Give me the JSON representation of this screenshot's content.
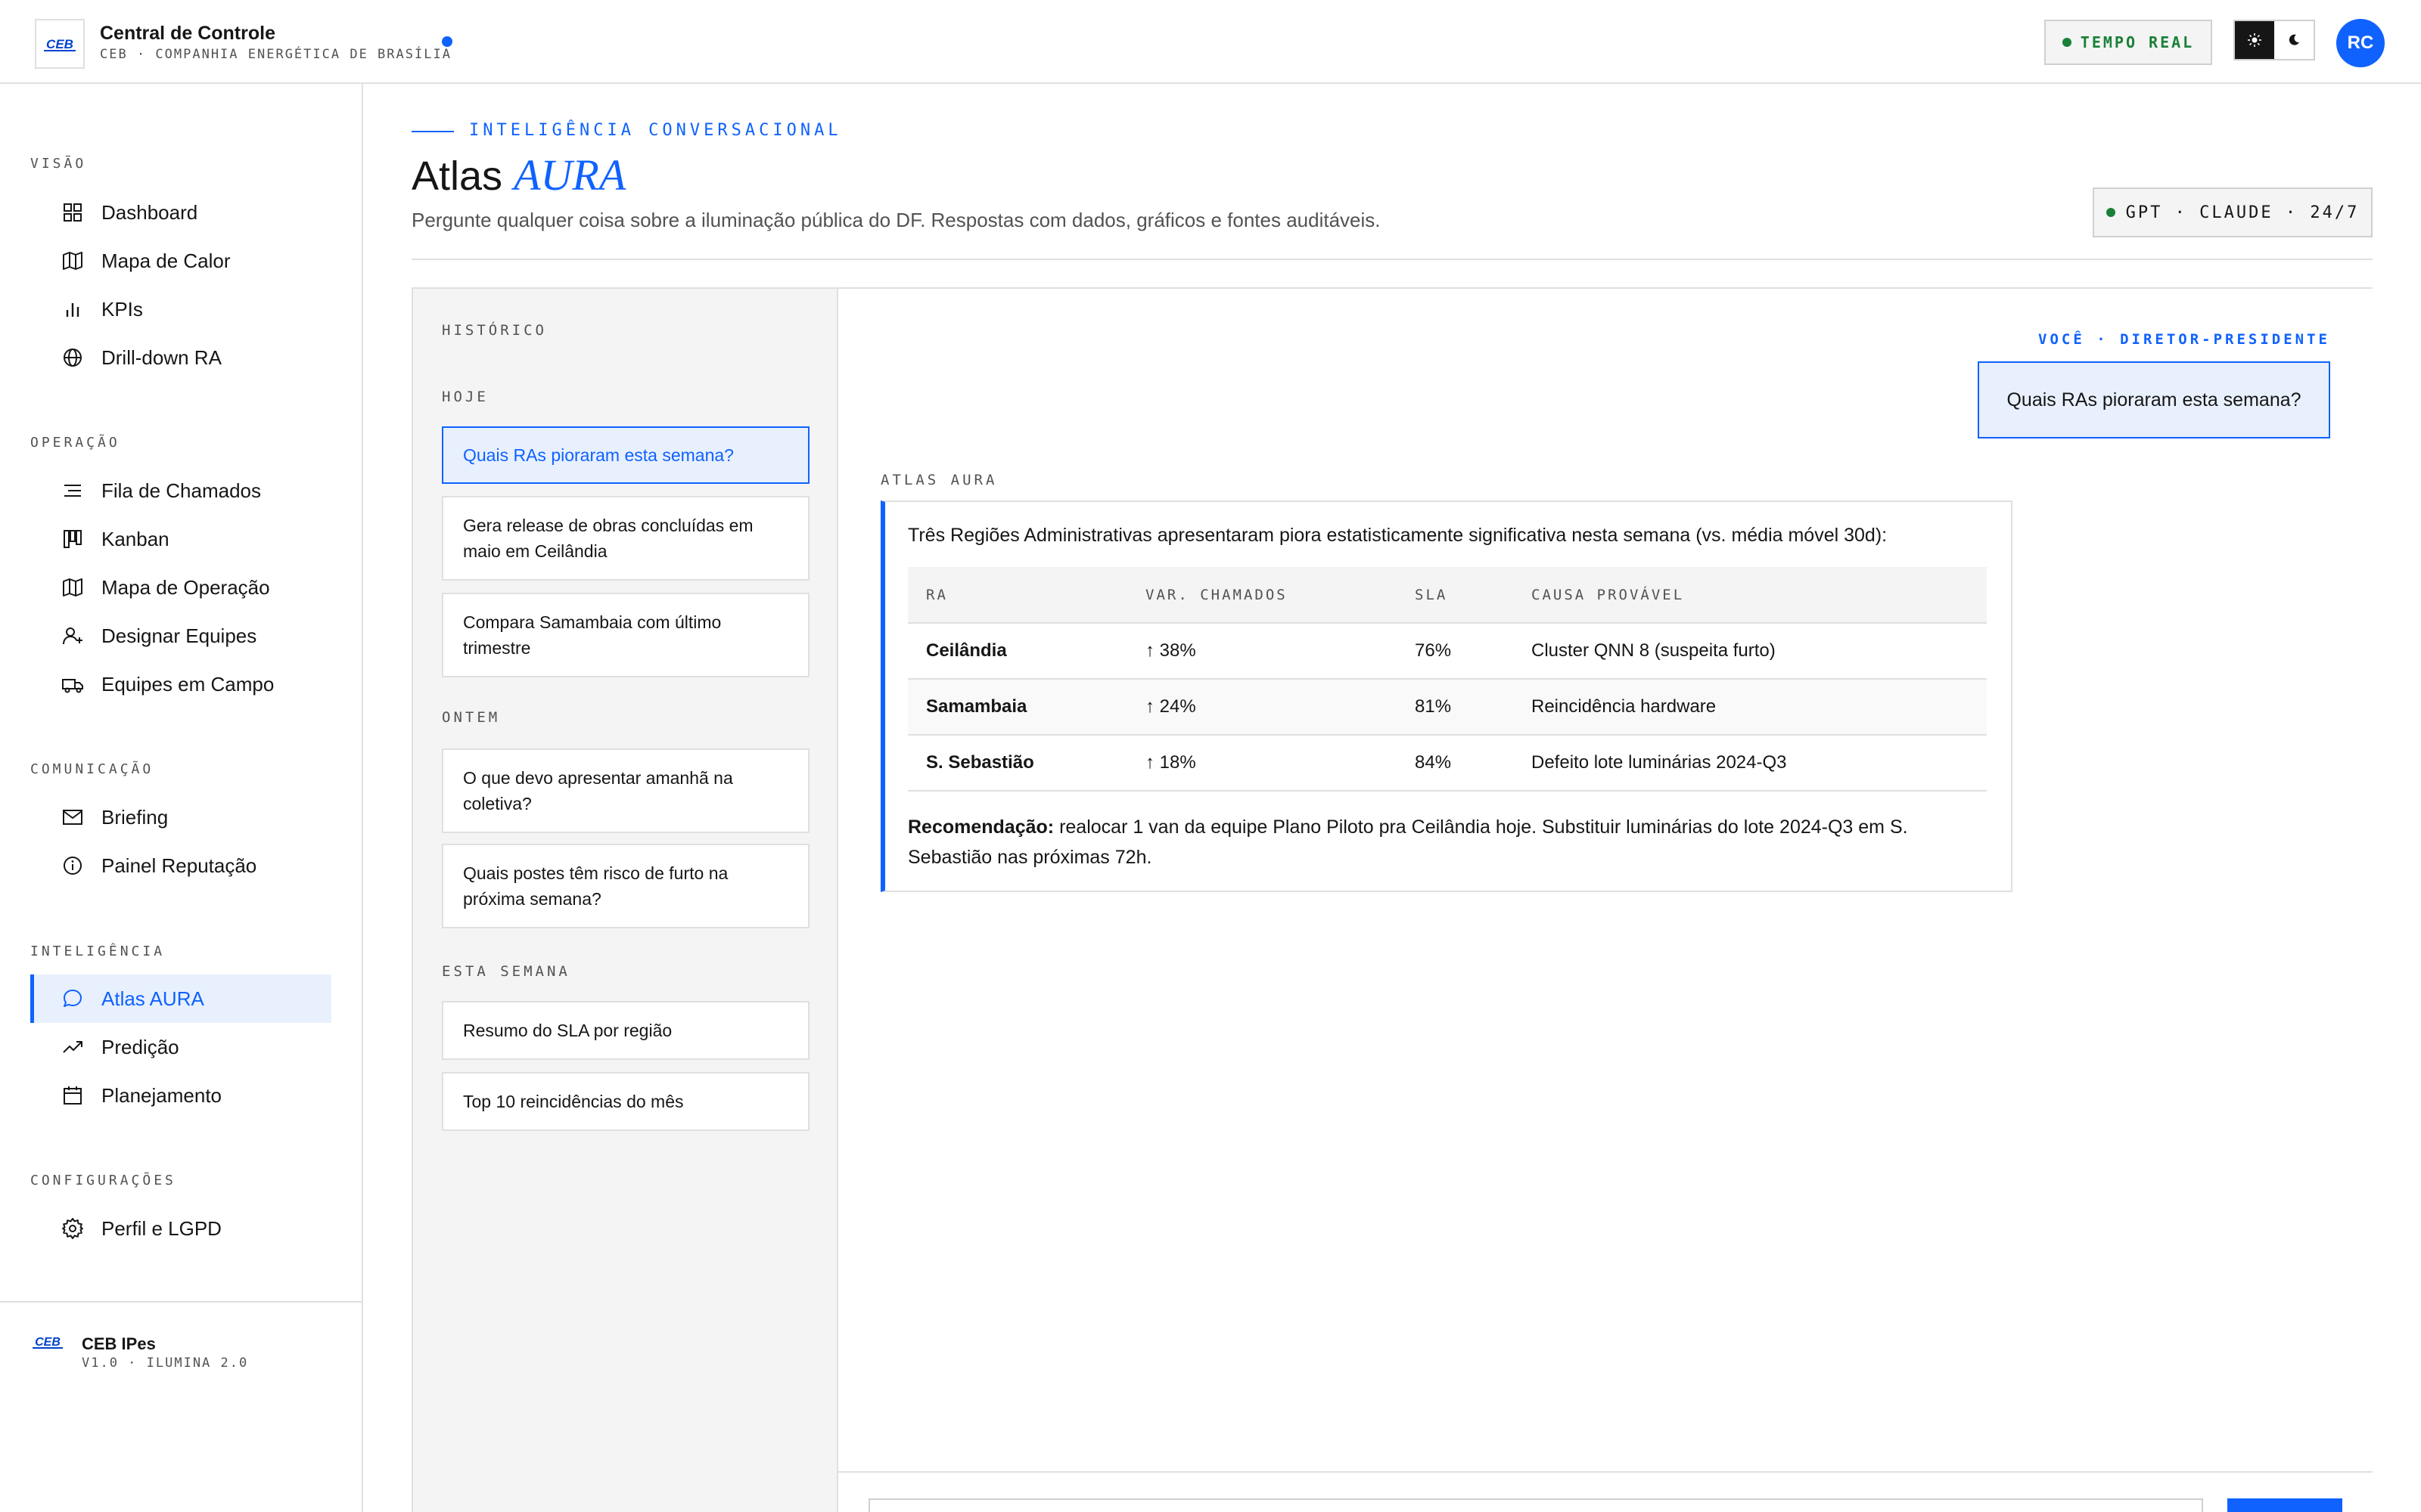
{
  "header": {
    "title": "Central de Controle",
    "subtitle": "CEB · COMPANHIA ENERGÉTICA DE BRASÍLIA",
    "realtime_label": "TEMPO REAL",
    "avatar_initials": "RC",
    "logo_text": "CEB"
  },
  "sidebar": {
    "sections": [
      {
        "label": "VISÃO",
        "items": [
          {
            "label": "Dashboard",
            "icon": "grid-icon"
          },
          {
            "label": "Mapa de Calor",
            "icon": "map-icon"
          },
          {
            "label": "KPIs",
            "icon": "bar-chart-icon"
          },
          {
            "label": "Drill-down RA",
            "icon": "globe-icon"
          }
        ]
      },
      {
        "label": "OPERAÇÃO",
        "items": [
          {
            "label": "Fila de Chamados",
            "icon": "list-icon"
          },
          {
            "label": "Kanban",
            "icon": "kanban-icon"
          },
          {
            "label": "Mapa de Operação",
            "icon": "map-icon"
          },
          {
            "label": "Designar Equipes",
            "icon": "user-plus-icon"
          },
          {
            "label": "Equipes em Campo",
            "icon": "truck-icon"
          }
        ]
      },
      {
        "label": "COMUNICAÇÃO",
        "items": [
          {
            "label": "Briefing",
            "icon": "mail-icon"
          },
          {
            "label": "Painel Reputação",
            "icon": "info-circle-icon"
          }
        ]
      },
      {
        "label": "INTELIGÊNCIA",
        "items": [
          {
            "label": "Atlas AURA",
            "icon": "chat-bubble-icon",
            "active": true
          },
          {
            "label": "Predição",
            "icon": "trend-up-icon"
          },
          {
            "label": "Planejamento",
            "icon": "calendar-icon"
          }
        ]
      },
      {
        "label": "CONFIGURAÇÕES",
        "items": [
          {
            "label": "Perfil e LGPD",
            "icon": "gear-icon"
          }
        ]
      }
    ],
    "footer": {
      "title": "CEB IPes",
      "version": "V1.0 · ILUMINA 2.0"
    }
  },
  "page": {
    "eyebrow": "INTELIGÊNCIA CONVERSACIONAL",
    "title_plain": "Atlas",
    "title_emphasis": "AURA",
    "description": "Pergunte qualquer coisa sobre a iluminação pública do DF. Respostas com dados, gráficos e fontes auditáveis.",
    "model_badge": "GPT · CLAUDE · 24/7"
  },
  "history": {
    "label": "HISTÓRICO",
    "groups": [
      {
        "label": "HOJE",
        "items": [
          "Quais RAs pioraram esta semana?",
          "Gera release de obras concluídas em maio em Ceilândia",
          "Compara Samambaia com último trimestre"
        ]
      },
      {
        "label": "ONTEM",
        "items": [
          "O que devo apresentar amanhã na coletiva?",
          "Quais postes têm risco de furto na próxima semana?"
        ]
      },
      {
        "label": "ESTA SEMANA",
        "items": [
          "Resumo do SLA por região",
          "Top 10 reincidências do mês"
        ]
      }
    ]
  },
  "chat": {
    "user_meta": "VOCÊ · DIRETOR-PRESIDENTE",
    "user_message": "Quais RAs pioraram esta semana?",
    "aura_meta": "ATLAS AURA",
    "aura_intro": "Três Regiões Administrativas apresentaram piora estatisticamente significativa nesta semana (vs. média móvel 30d):",
    "table": {
      "headers": [
        "RA",
        "VAR. CHAMADOS",
        "SLA",
        "CAUSA PROVÁVEL"
      ],
      "rows": [
        {
          "ra": "Ceilândia",
          "var": "↑ 38%",
          "sla": "76%",
          "cause": "Cluster QNN 8 (suspeita furto)"
        },
        {
          "ra": "Samambaia",
          "var": "↑ 24%",
          "sla": "81%",
          "cause": "Reincidência hardware"
        },
        {
          "ra": "S. Sebastião",
          "var": "↑ 18%",
          "sla": "84%",
          "cause": "Defeito lote luminárias 2024-Q3"
        }
      ]
    },
    "recommendation_label": "Recomendação:",
    "recommendation_text": " realocar 1 van da equipe Plano Piloto pra Ceilândia hoje. Substituir luminárias do lote 2024-Q3 em S. Sebastião nas próximas 72h."
  },
  "colors": {
    "accent": "#0f62fe",
    "positive": "#198038",
    "danger": "#da1e28",
    "warning": "#b86e00"
  }
}
